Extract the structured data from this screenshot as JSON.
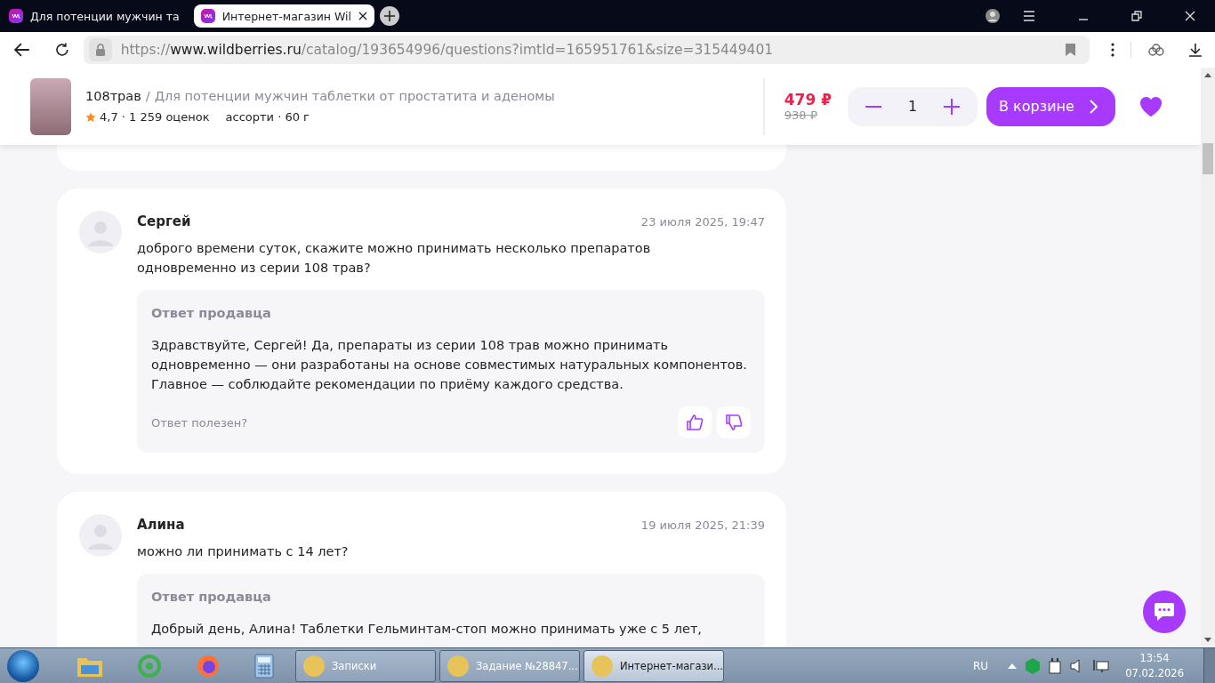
{
  "browser": {
    "tabs": [
      {
        "title": "Для потенции мужчин та",
        "selected": false
      },
      {
        "title": "Интернет-магазин Wil",
        "selected": true
      }
    ],
    "url_scheme": "https://",
    "url_host": "www.wildberries.ru",
    "url_path": "/catalog/193654996/questions?imtId=165951761&size=315449401"
  },
  "product_bar": {
    "brand": "108трав",
    "separator": "/",
    "title": "Для потенции мужчин таблетки от простатита и аденомы",
    "rating_line": "4,7 · 1 259 оценок",
    "variant_line": "ассорти · 60 г",
    "price": "479 ₽",
    "old_price": "938 ₽",
    "quantity": "1",
    "cart_button": "В корзине",
    "favorite": true
  },
  "questions": [
    {
      "author": "Сергей",
      "date": "23 июля 2025, 19:47",
      "text": "доброго времени суток, скажите можно принимать несколько препаратов\nодновременно из серии 108 трав?",
      "answer": {
        "label": "Ответ продавца",
        "text": "Здравствуйте, Сергей! Да, препараты из серии 108 трав можно принимать\nодновременно — они разработаны на основе совместимых натуральных компонентов.\nГлавное — соблюдайте рекомендации по приёму каждого средства.",
        "helpful_prompt": "Ответ полезен?"
      }
    },
    {
      "author": "Алина",
      "date": "19 июля 2025, 21:39",
      "text": "можно ли принимать с 14 лет?",
      "answer": {
        "label": "Ответ продавца",
        "text": "Добрый день, Алина! Таблетки Гельминтам-стоп можно принимать уже с 5 лет,"
      }
    }
  ],
  "taskbar": {
    "windows": [
      {
        "title": "Записки",
        "selected": false
      },
      {
        "title": "Задание №28847...",
        "selected": false
      },
      {
        "title": "Интернет-магази...",
        "selected": true
      }
    ],
    "language": "RU",
    "time": "13:54",
    "date": "07.02.2026"
  }
}
